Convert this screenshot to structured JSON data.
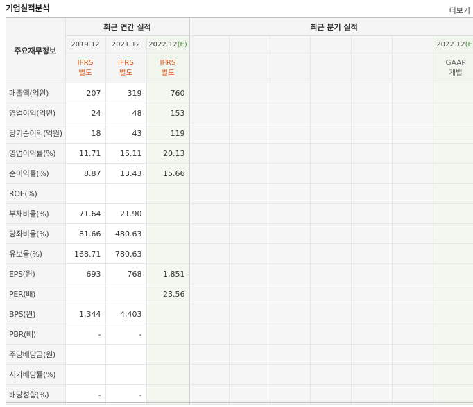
{
  "section_title": "기업실적분석",
  "more_link": "더보기",
  "header": {
    "row_label": "주요재무정보",
    "annual_title": "최근 연간 실적",
    "quarterly_title": "최근 분기 실적",
    "annual_periods": [
      "2019.12",
      "2021.12",
      "2022.12(E)"
    ],
    "annual_types": [
      {
        "line1": "IFRS",
        "line2": "별도"
      },
      {
        "line1": "IFRS",
        "line2": "별도"
      },
      {
        "line1": "IFRS",
        "line2": "별도"
      }
    ],
    "quarter_last_period": "2022.12(E)",
    "quarter_last_type": {
      "line1": "GAAP",
      "line2": "개별"
    }
  },
  "rows": [
    {
      "label": "매출액(억원)",
      "values": [
        "207",
        "319",
        "760"
      ]
    },
    {
      "label": "영업이익(억원)",
      "values": [
        "24",
        "48",
        "153"
      ]
    },
    {
      "label": "당기순이익(억원)",
      "values": [
        "18",
        "43",
        "119"
      ]
    },
    {
      "label": "영업이익률(%)",
      "values": [
        "11.71",
        "15.11",
        "20.13"
      ]
    },
    {
      "label": "순이익률(%)",
      "values": [
        "8.87",
        "13.43",
        "15.66"
      ]
    },
    {
      "label": "ROE(%)",
      "values": [
        "",
        "",
        ""
      ]
    },
    {
      "label": "부채비율(%)",
      "values": [
        "71.64",
        "21.90",
        ""
      ]
    },
    {
      "label": "당좌비율(%)",
      "values": [
        "81.66",
        "480.63",
        ""
      ]
    },
    {
      "label": "유보율(%)",
      "values": [
        "168.71",
        "780.63",
        ""
      ]
    },
    {
      "label": "EPS(원)",
      "values": [
        "693",
        "768",
        "1,851"
      ]
    },
    {
      "label": "PER(배)",
      "values": [
        "",
        "",
        "23.56"
      ]
    },
    {
      "label": "BPS(원)",
      "values": [
        "1,344",
        "4,403",
        ""
      ]
    },
    {
      "label": "PBR(배)",
      "values": [
        "-",
        "-",
        ""
      ]
    },
    {
      "label": "주당배당금(원)",
      "values": [
        "",
        "",
        ""
      ]
    },
    {
      "label": "시가배당률(%)",
      "values": [
        "",
        "",
        ""
      ]
    },
    {
      "label": "배당성향(%)",
      "values": [
        "-",
        "-",
        ""
      ]
    }
  ]
}
